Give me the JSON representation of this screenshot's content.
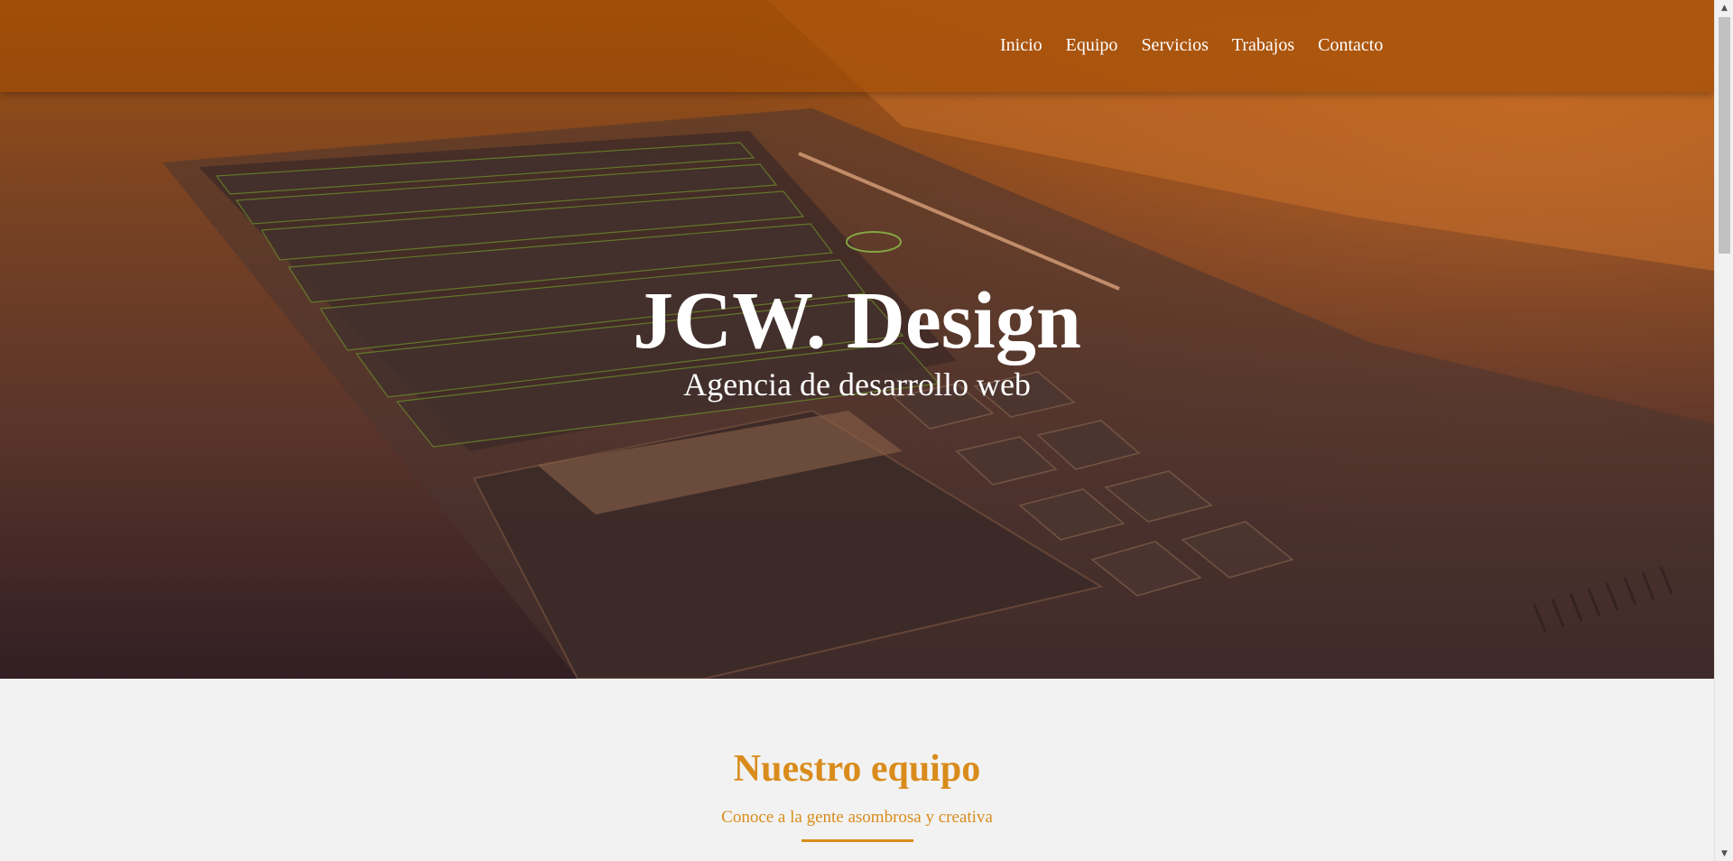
{
  "nav": {
    "items": [
      {
        "label": "Inicio"
      },
      {
        "label": "Equipo"
      },
      {
        "label": "Servicios"
      },
      {
        "label": "Trabajos"
      },
      {
        "label": "Contacto"
      }
    ]
  },
  "hero": {
    "title": "JCW. Design",
    "subtitle": "Agencia de desarrollo web"
  },
  "team": {
    "title": "Nuestro equipo",
    "subtitle": "Conoce a la gente asombrosa y creativa"
  },
  "colors": {
    "accent": "#d98c1c",
    "overlay_top": "#a04c04",
    "overlay_bottom": "#301e24"
  }
}
